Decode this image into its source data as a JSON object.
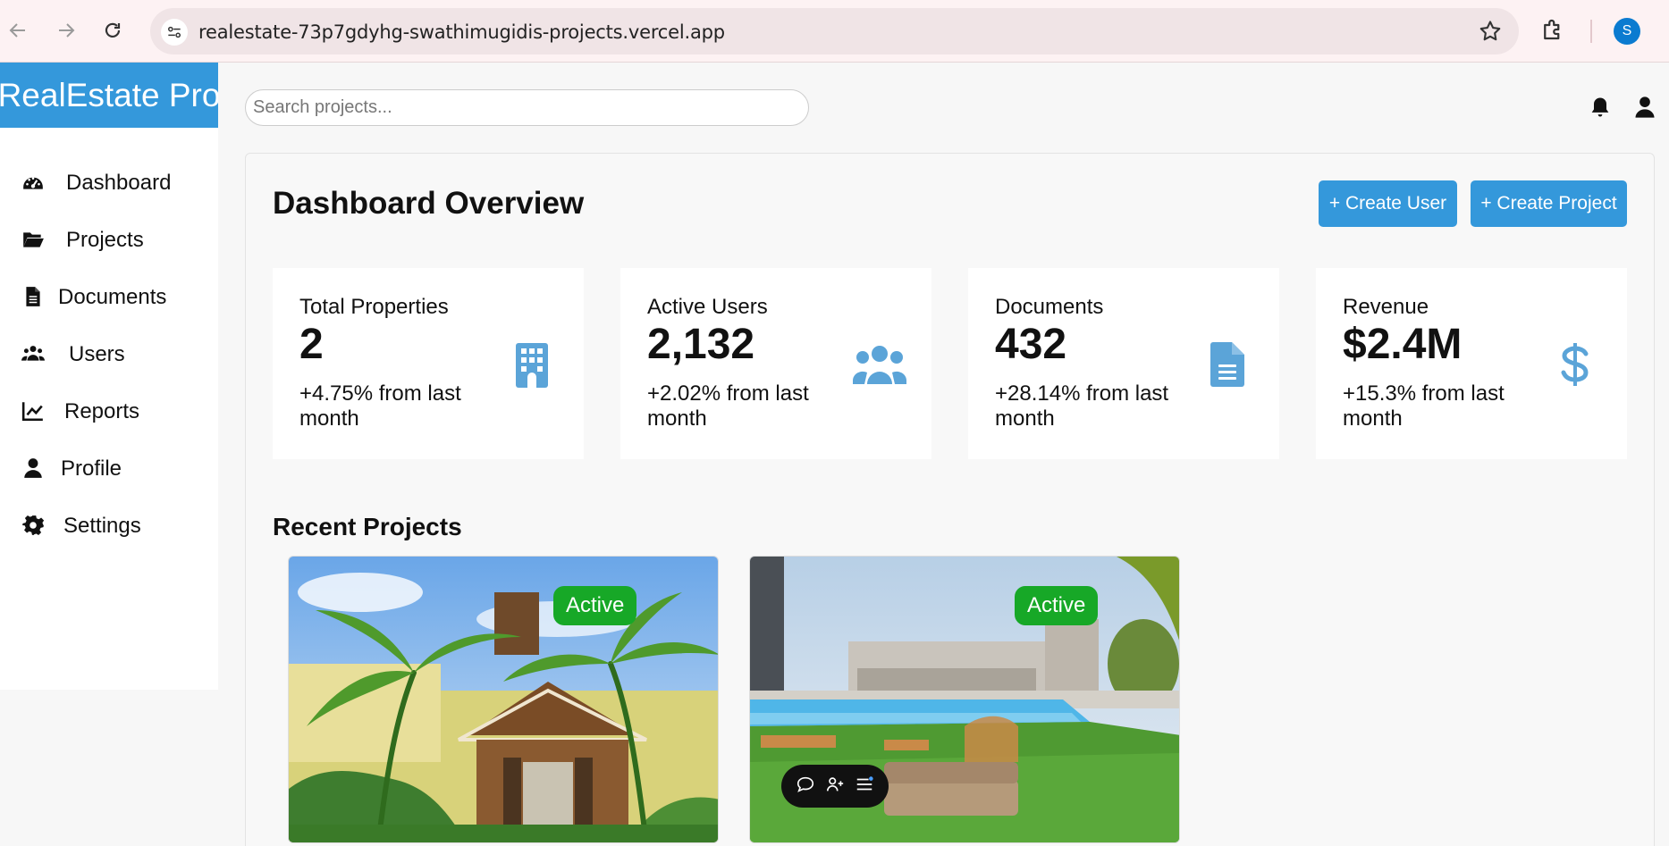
{
  "browser": {
    "url": "realestate-73p7gdyhg-swathimugidis-projects.vercel.app",
    "profile_initial": "S",
    "icons": [
      "back-arrow-icon",
      "forward-arrow-icon",
      "reload-icon",
      "site-settings-icon",
      "bookmark-star-icon",
      "extensions-icon"
    ]
  },
  "app": {
    "brand": "RealEstate Pro"
  },
  "sidebar": {
    "items": [
      {
        "label": "Dashboard",
        "icon": "gauge-icon"
      },
      {
        "label": "Projects",
        "icon": "folder-open-icon"
      },
      {
        "label": "Documents",
        "icon": "file-icon"
      },
      {
        "label": "Users",
        "icon": "users-icon"
      },
      {
        "label": "Reports",
        "icon": "line-chart-icon"
      },
      {
        "label": "Profile",
        "icon": "user-icon"
      },
      {
        "label": "Settings",
        "icon": "gear-icon"
      }
    ]
  },
  "topbar": {
    "search_placeholder": "Search projects...",
    "icons": [
      "bell-icon",
      "user-icon"
    ]
  },
  "main": {
    "title": "Dashboard Overview",
    "create_user_label": "+ Create User",
    "create_project_label": "+ Create Project",
    "stats": [
      {
        "label": "Total Properties",
        "value": "2",
        "change": "+4.75% from last month",
        "icon": "building-icon"
      },
      {
        "label": "Active Users",
        "value": "2,132",
        "change": "+2.02% from last month",
        "icon": "users-icon"
      },
      {
        "label": "Documents",
        "value": "432",
        "change": "+28.14% from last month",
        "icon": "file-lines-icon"
      },
      {
        "label": "Revenue",
        "value": "$2.4M",
        "change": "+15.3% from last month",
        "icon": "dollar-icon"
      }
    ],
    "recent_title": "Recent Projects",
    "projects": [
      {
        "status": "Active"
      },
      {
        "status": "Active"
      }
    ]
  },
  "colors": {
    "accent": "#3498db",
    "icon_blue": "#5ba4d8",
    "status_active": "#17a827",
    "browser_frame": "#fdf2f3"
  }
}
